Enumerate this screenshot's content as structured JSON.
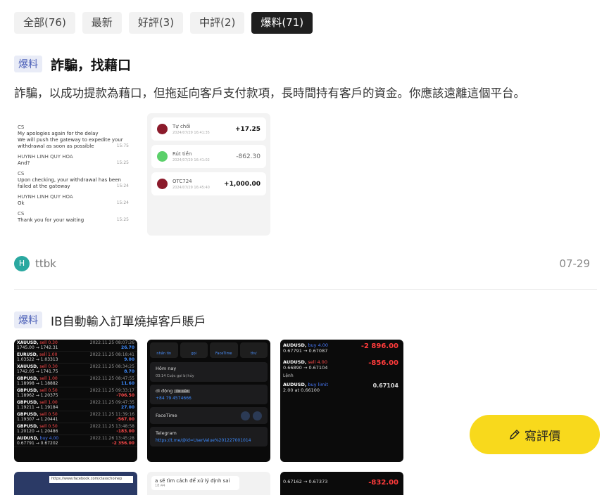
{
  "tabs": [
    {
      "label": "全部(76)",
      "active": false
    },
    {
      "label": "最新",
      "active": false
    },
    {
      "label": "好評(3)",
      "active": false
    },
    {
      "label": "中評(2)",
      "active": false
    },
    {
      "label": "爆料(71)",
      "active": true
    }
  ],
  "post1": {
    "badge": "爆料",
    "title": "詐騙，找藉口",
    "desc": "詐騙，以成功提款為藉口，但拖延向客戶支付款項，長時間持有客戶的資金。你應該遠離這個平台。",
    "chat": [
      {
        "who": "CS",
        "text": "My apologies again for the delay\nWe will push the gateway to expedite your withdrawal as soon as possible",
        "time": "15:75"
      },
      {
        "who": "HUYNH LINH QUY HOA",
        "text": "And?",
        "time": "15:25"
      },
      {
        "who": "CS",
        "text": "Upon checking, your withdrawal has been failed at the gateway",
        "time": "15:24"
      },
      {
        "who": "HUYNH LINH QUY HOA",
        "text": "Ok",
        "time": "15:24"
      },
      {
        "who": "CS",
        "text": "Thank you for your waiting",
        "time": "15:25"
      }
    ],
    "transactions": [
      {
        "name": "Tự chối",
        "sub": "2024/07/29 16:41:35",
        "amount": "+17.25",
        "color": "#8b1a2b"
      },
      {
        "name": "Rút tiền",
        "sub": "2024/07/29 16:41:02",
        "amount": "-862.30",
        "color": "#5bd06a"
      },
      {
        "name": "OTC724",
        "sub": "2024/07/29 16:45:40",
        "amount": "+1,000.00",
        "color": "#8b1a2b"
      }
    ],
    "avatar_letter": "H",
    "user": "ttbk",
    "date": "07-29"
  },
  "post2": {
    "badge": "爆料",
    "title": "IB自動輸入訂單燒掉客戶賬戶",
    "trades": [
      {
        "sym": "XAUUSD,",
        "side": "sell 0.30",
        "side_type": "sell",
        "price": "1745.00 → 1742.31",
        "dt": "2022.11.25 08:07:26",
        "pl": "26.70",
        "pl_type": "pos"
      },
      {
        "sym": "EURUSD,",
        "side": "sell 1.00",
        "side_type": "sell",
        "price": "1.03522 → 1.03313",
        "dt": "2022.11.25 08:18:41",
        "pl": "9.00",
        "pl_type": "pos"
      },
      {
        "sym": "XAUUSD,",
        "side": "sell 0.30",
        "side_type": "sell",
        "price": "1742.05 → 1741.75",
        "dt": "2022.11.25 08:34:25",
        "pl": "8.70",
        "pl_type": "pos"
      },
      {
        "sym": "GBPUSD,",
        "side": "sell 1.00",
        "side_type": "sell",
        "price": "1.18998 → 1.18882",
        "dt": "2022.11.25 08:47:55",
        "pl": "11.60",
        "pl_type": "pos"
      },
      {
        "sym": "GBPUSD,",
        "side": "sell 0.50",
        "side_type": "sell",
        "price": "1.18962 → 1.20375",
        "dt": "2022.11.25 09:33:17",
        "pl": "-706.50",
        "pl_type": "neg"
      },
      {
        "sym": "GBPUSD,",
        "side": "sell 1.00",
        "side_type": "sell",
        "price": "1.19211 → 1.19184",
        "dt": "2022.11.25 09:47:35",
        "pl": "27.00",
        "pl_type": "pos"
      },
      {
        "sym": "GBPUSD,",
        "side": "sell 0.50",
        "side_type": "sell",
        "price": "1.19307 → 1.20441",
        "dt": "2022.11.25 11:39:16",
        "pl": "-567.00",
        "pl_type": "neg"
      },
      {
        "sym": "GBPUSD,",
        "side": "sell 0.50",
        "side_type": "sell",
        "price": "1.20120 → 1.20486",
        "dt": "2022.11.25 13:48:58",
        "pl": "-183.00",
        "pl_type": "neg"
      },
      {
        "sym": "AUDUSD,",
        "side": "buy 4.00",
        "side_type": "buy",
        "price": "0.67791 → 0.67202",
        "dt": "2022.11.26 13:45:28",
        "pl": "-2 356.00",
        "pl_type": "neg"
      }
    ],
    "phone": {
      "tabs": [
        "nhắn tin",
        "gọi",
        "FaceTime",
        "thư"
      ],
      "today": "Hôm nay",
      "call": "03:14   Cuộc gọi bị hủy",
      "mobile_label": "di động",
      "mobile_tag": "TÌM KIẾM",
      "mobile_number": "+84 79 4574666",
      "facetime": "FaceTime",
      "telegram": "Telegram",
      "telegram_link": "https://t.me/@id=UserValue%201227001014"
    },
    "fx": [
      {
        "sym": "AUDUSD,",
        "side": "buy 4.00",
        "side_type": "buy",
        "price": "0.67791 → 0.67087",
        "val": "-2 896.00",
        "val_type": "neg"
      },
      {
        "sym": "AUDUSD,",
        "side": "sell 4.00",
        "side_type": "sell",
        "price": "0.66890 → 0.67104",
        "val": "-856.00",
        "val_type": "neg"
      },
      {
        "sym": "Lệnh",
        "side": "",
        "side_type": "",
        "price": "",
        "val": "",
        "val_type": ""
      },
      {
        "sym": "AUDUSD,",
        "side": "buy limit",
        "side_type": "buy",
        "price": "2.00 at 0.66100",
        "val": "0.67104",
        "val_type": "w"
      }
    ],
    "row2": {
      "fb_url": "https://www.facebook.com/classchoinep",
      "chat_text": "a sẽ tìm cách để xử lý định sai",
      "chat_time": "18:44",
      "fx_price": "0.67162 → 0.67373",
      "fx_val": "-832.00"
    }
  },
  "fab_label": "寫評價"
}
